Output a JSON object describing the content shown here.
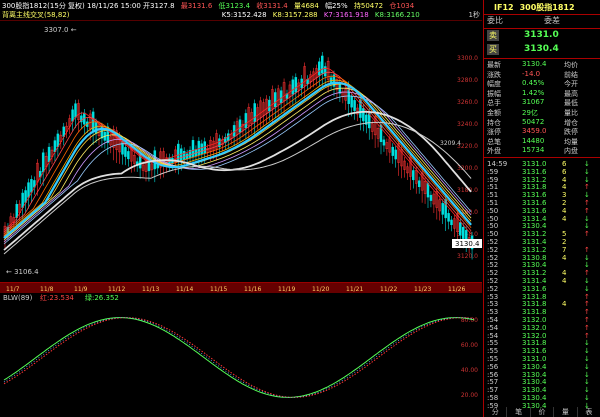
{
  "header": {
    "title": "300股指1812(15分 复权) 18/11/26 15:00 开3127.8",
    "vals": [
      "最3131.6",
      "低3123.4",
      "收3131.4",
      "量4684",
      "幅25%",
      "持50472",
      "仓1034"
    ],
    "sub_label": "背离主线交叉(58,82)",
    "mas": [
      "K5:3152.428",
      "K8:3157.288",
      "K7:3161.918",
      "K8:3166.210"
    ],
    "right_tag": "1秒"
  },
  "chart_labels": {
    "high_label": "3307.0",
    "low_label": "3106.4",
    "last_price_tag": "3130.4",
    "ref_price": "3209.4"
  },
  "y_ticks": [
    "3300.0",
    "3280.0",
    "3260.0",
    "3240.0",
    "3220.0",
    "3200.0",
    "3180.0",
    "3160.0",
    "3140.0",
    "3120.0"
  ],
  "x_ticks": [
    "11/7",
    "11/8",
    "11/9",
    "11/12",
    "11/13",
    "11/14",
    "11/15",
    "11/16",
    "11/19",
    "11/20",
    "11/21",
    "11/22",
    "11/23",
    "11/26"
  ],
  "osc": {
    "title": "BLW(89)",
    "v1": "红:23.534",
    "v2": "绿:26.352",
    "y_ticks": [
      "80.00",
      "60.00",
      "40.00",
      "20.00"
    ]
  },
  "side": {
    "contract": "IF12",
    "name": "300股指1812",
    "tabs": [
      "委比",
      "委差"
    ],
    "sell_label": "卖",
    "sell_price": "3131.0",
    "buy_label": "买",
    "buy_price": "3130.4",
    "stats": [
      [
        "最新",
        "3130.4",
        "均价",
        ""
      ],
      [
        "涨跌",
        "-14.0",
        "前结",
        ""
      ],
      [
        "幅度",
        "0.45%",
        "今开",
        ""
      ],
      [
        "振幅",
        "1.42%",
        "最高",
        ""
      ],
      [
        "总手",
        "31067",
        "最低",
        ""
      ],
      [
        "金额",
        "29亿",
        "量比",
        ""
      ],
      [
        "持仓",
        "50472",
        "增仓",
        ""
      ],
      [
        "涨停",
        "3459.0",
        "跌停",
        ""
      ],
      [
        "总笔",
        "14480",
        "均量",
        ""
      ],
      [
        "外盘",
        "15734",
        "内盘",
        ""
      ]
    ],
    "ticks": [
      [
        "14:59",
        "3131.0",
        "6",
        "↓"
      ],
      [
        ":59",
        "3131.6",
        "6",
        "↓"
      ],
      [
        ":59",
        "3131.2",
        "4",
        "↓"
      ],
      [
        ":51",
        "3131.8",
        "4",
        "↑"
      ],
      [
        ":51",
        "3131.6",
        "3",
        "↓"
      ],
      [
        ":51",
        "3131.6",
        "2",
        "↑"
      ],
      [
        ":50",
        "3131.6",
        "4",
        "↑"
      ],
      [
        ":50",
        "3131.4",
        "4",
        "↓"
      ],
      [
        ":50",
        "3130.4",
        "",
        "↓"
      ],
      [
        ":50",
        "3131.2",
        "5",
        "↑"
      ],
      [
        ":52",
        "3131.4",
        "2",
        ""
      ],
      [
        ":52",
        "3131.2",
        "7",
        "↑"
      ],
      [
        ":52",
        "3130.8",
        "4",
        "↓"
      ],
      [
        ":52",
        "3130.4",
        "",
        "↓"
      ],
      [
        ":52",
        "3131.2",
        "4",
        "↑"
      ],
      [
        ":52",
        "3131.4",
        "4",
        "↓"
      ],
      [
        ":52",
        "3131.6",
        "",
        "↓"
      ],
      [
        ":53",
        "3131.8",
        "",
        "↑"
      ],
      [
        ":53",
        "3131.8",
        "4",
        "↑"
      ],
      [
        ":53",
        "3131.8",
        "",
        "↑"
      ],
      [
        ":54",
        "3132.0",
        "",
        "↑"
      ],
      [
        ":54",
        "3132.0",
        "",
        "↑"
      ],
      [
        ":54",
        "3132.0",
        "",
        "↑"
      ],
      [
        ":55",
        "3131.8",
        "",
        "↓"
      ],
      [
        ":55",
        "3131.6",
        "",
        "↓"
      ],
      [
        ":55",
        "3131.0",
        "",
        "↓"
      ],
      [
        ":56",
        "3130.4",
        "",
        "↓"
      ],
      [
        ":56",
        "3130.4",
        "",
        "↓"
      ],
      [
        ":57",
        "3130.4",
        "",
        "↓"
      ],
      [
        ":57",
        "3130.4",
        "",
        "↓"
      ],
      [
        ":58",
        "3130.4",
        "",
        "↓"
      ],
      [
        ":59",
        "3130.4",
        "",
        "↓"
      ]
    ],
    "bottom_tabs": [
      "分",
      "笔",
      "价",
      "量",
      "表"
    ]
  },
  "colors": {
    "up": "#ff3333",
    "down": "#00e0e0",
    "ma_cyan": "#33ccff",
    "ma_white": "#e0e0e0",
    "accent_yellow": "#ffff66"
  }
}
